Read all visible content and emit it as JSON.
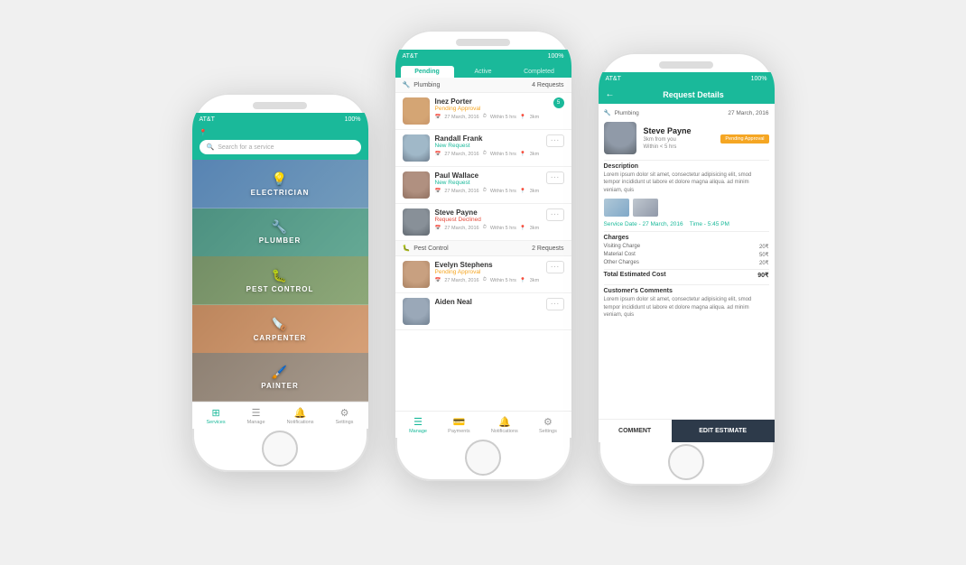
{
  "phones": {
    "p1": {
      "statusBar": {
        "carrier": "AT&T",
        "signal": "●●●●●",
        "wifi": "▲",
        "battery": "100%"
      },
      "header": {
        "location": "📍",
        "searchPlaceholder": "Search for a service"
      },
      "services": [
        {
          "id": "electrician",
          "label": "ELECTRICIAN",
          "icon": "💡"
        },
        {
          "id": "plumber",
          "label": "PLUMBER",
          "icon": "🔧"
        },
        {
          "id": "pestcontrol",
          "label": "PEST CONTROL",
          "icon": "🐛"
        },
        {
          "id": "carpenter",
          "label": "CARPENTER",
          "icon": "🪚"
        },
        {
          "id": "painter",
          "label": "PAINTER",
          "icon": "🖌️"
        }
      ],
      "nav": [
        {
          "id": "services",
          "label": "Services",
          "icon": "⊞",
          "active": true
        },
        {
          "id": "manage",
          "label": "Manage",
          "icon": "☰",
          "active": false
        },
        {
          "id": "notifications",
          "label": "Notifications",
          "icon": "🔔",
          "active": false
        },
        {
          "id": "settings",
          "label": "Settings",
          "icon": "⚙",
          "active": false
        }
      ]
    },
    "p2": {
      "statusBar": {
        "carrier": "AT&T",
        "signal": "●●●●●",
        "wifi": "▲",
        "battery": "100%"
      },
      "tabs": [
        {
          "id": "pending",
          "label": "Pending",
          "active": true
        },
        {
          "id": "active",
          "label": "Active",
          "active": false
        },
        {
          "id": "completed",
          "label": "Completed",
          "active": false
        }
      ],
      "sections": [
        {
          "id": "plumbing",
          "title": "Plumbing",
          "requestCount": "4 Requests",
          "requests": [
            {
              "id": "r1",
              "name": "Inez Porter",
              "status": "Pending Approval",
              "statusClass": "status-pending",
              "date": "27 March, 2016",
              "time": "Within 5 hrs",
              "distance": "3km",
              "hasBadge": true,
              "badgeCount": "5",
              "avatarClass": "face-inez"
            },
            {
              "id": "r2",
              "name": "Randall Frank",
              "status": "New Request",
              "statusClass": "status-new",
              "date": "27 March, 2016",
              "time": "Within 5 hrs",
              "distance": "3km",
              "hasBadge": false,
              "avatarClass": "face-randall"
            },
            {
              "id": "r3",
              "name": "Paul Wallace",
              "status": "New Request",
              "statusClass": "status-new",
              "date": "27 March, 2016",
              "time": "Within 5 hrs",
              "distance": "3km",
              "hasBadge": false,
              "avatarClass": "face-paul"
            },
            {
              "id": "r4",
              "name": "Steve Payne",
              "status": "Request Declined",
              "statusClass": "status-declined",
              "date": "27 March, 2016",
              "time": "Within 5 hrs",
              "distance": "3km",
              "hasBadge": false,
              "avatarClass": "face-steve"
            }
          ]
        },
        {
          "id": "pestcontrol",
          "title": "Pest Control",
          "requestCount": "2 Requests",
          "requests": [
            {
              "id": "r5",
              "name": "Evelyn Stephens",
              "status": "Pending Approval",
              "statusClass": "status-pending",
              "date": "27 March, 2016",
              "time": "Within 5 hrs",
              "distance": "3km",
              "hasBadge": false,
              "avatarClass": "face-evelyn"
            },
            {
              "id": "r6",
              "name": "Aiden Neal",
              "status": "",
              "statusClass": "",
              "date": "27 March, 2016",
              "time": "Within 5 hrs",
              "distance": "3km",
              "hasBadge": false,
              "avatarClass": "face-aiden"
            }
          ]
        }
      ],
      "nav": [
        {
          "id": "manage",
          "label": "Manage",
          "icon": "☰",
          "active": true
        },
        {
          "id": "payments",
          "label": "Payments",
          "icon": "💳",
          "active": false
        },
        {
          "id": "notifications",
          "label": "Notifications",
          "icon": "🔔",
          "active": false
        },
        {
          "id": "settings",
          "label": "Settings",
          "icon": "⚙",
          "active": false
        }
      ]
    },
    "p3": {
      "statusBar": {
        "carrier": "AT&T",
        "signal": "●●●●●",
        "wifi": "▲",
        "battery": "100%"
      },
      "header": {
        "title": "Request Details"
      },
      "serviceRow": {
        "icon": "🔧",
        "label": "Plumbing",
        "date": "27 March, 2016"
      },
      "provider": {
        "name": "Steve Payne",
        "distance": "3km from you",
        "timeEstimate": "Within < 5 hrs",
        "statusLabel": "Pending Approval"
      },
      "description": {
        "title": "Description",
        "text": "Lorem ipsum dolor sit amet, consectetur adipisicing elit, smod tempor incididunt ut labore et dolore magna aliqua. ad minim veniam, quis"
      },
      "serviceDate": "Service Date - 27 March, 2016",
      "serviceTime": "Time - 5:45 PM",
      "charges": {
        "title": "Charges",
        "items": [
          {
            "label": "Visiting Charge",
            "value": "20₹"
          },
          {
            "label": "Material Cost",
            "value": "50₹"
          },
          {
            "label": "Other Charges",
            "value": "20₹"
          }
        ],
        "total": {
          "label": "Total Estimated Cost",
          "value": "90₹"
        }
      },
      "customersComments": {
        "title": "Customer's Comments",
        "text": "Lorem ipsum dolor sit amet, consectetur adipisicing elit, smod tempor incididunt ut labore et dolore magna aliqua. ad minim veniam, quis"
      },
      "footer": {
        "commentBtn": "COMMENT",
        "estimateBtn": "EDIT ESTIMATE"
      }
    }
  }
}
